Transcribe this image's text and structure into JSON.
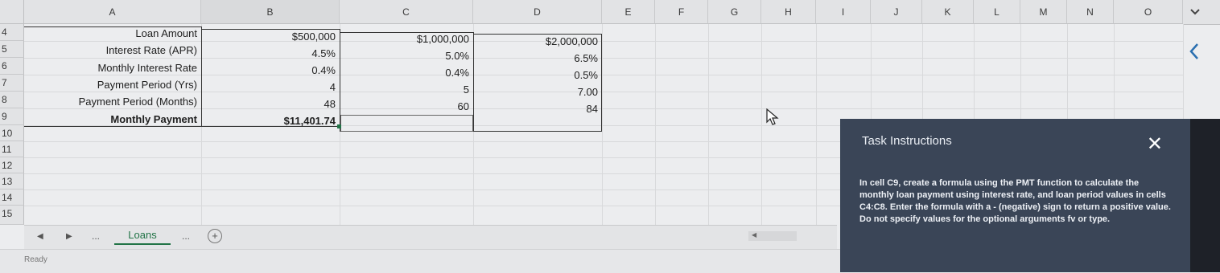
{
  "columns": [
    "A",
    "B",
    "C",
    "D",
    "E",
    "F",
    "G",
    "H",
    "I",
    "J",
    "K",
    "L",
    "M",
    "N",
    "O"
  ],
  "rows": [
    "4",
    "5",
    "6",
    "7",
    "8",
    "9",
    "10",
    "11",
    "12",
    "13",
    "14",
    "15"
  ],
  "cells": {
    "A4": "Loan Amount",
    "A5": "Interest Rate (APR)",
    "A6": "Monthly Interest Rate",
    "A7": "Payment Period (Yrs)",
    "A8": "Payment Period (Months)",
    "A9": "Monthly Payment",
    "B4": "$500,000",
    "B5": "4.5%",
    "B6": "0.4%",
    "B7": "4",
    "B8": "48",
    "B9": "$11,401.74",
    "C4": "$1,000,000",
    "C5": "5.0%",
    "C6": "0.4%",
    "C7": "5",
    "C8": "60",
    "D4": "$2,000,000",
    "D5": "6.5%",
    "D6": "0.5%",
    "D7": "7.00",
    "D8": "84"
  },
  "sheet_tabs": {
    "active": "Loans",
    "ellipsis": "...",
    "add": "+"
  },
  "status_bar": {
    "text": "Ready"
  },
  "task_panel": {
    "title": "Task Instructions",
    "close": "✕",
    "text": "In cell C9, create a formula using the PMT function to calculate the monthly loan payment using interest rate, and loan period values in cells C4:C8. Enter the formula with a - (negative) sign to return a positive value. Do not specify values for the optional arguments fv or type."
  },
  "icons": {
    "collapse": "chevron-down-icon",
    "sidepanel": "chevron-left-icon",
    "cursor": "mouse-pointer-icon"
  }
}
